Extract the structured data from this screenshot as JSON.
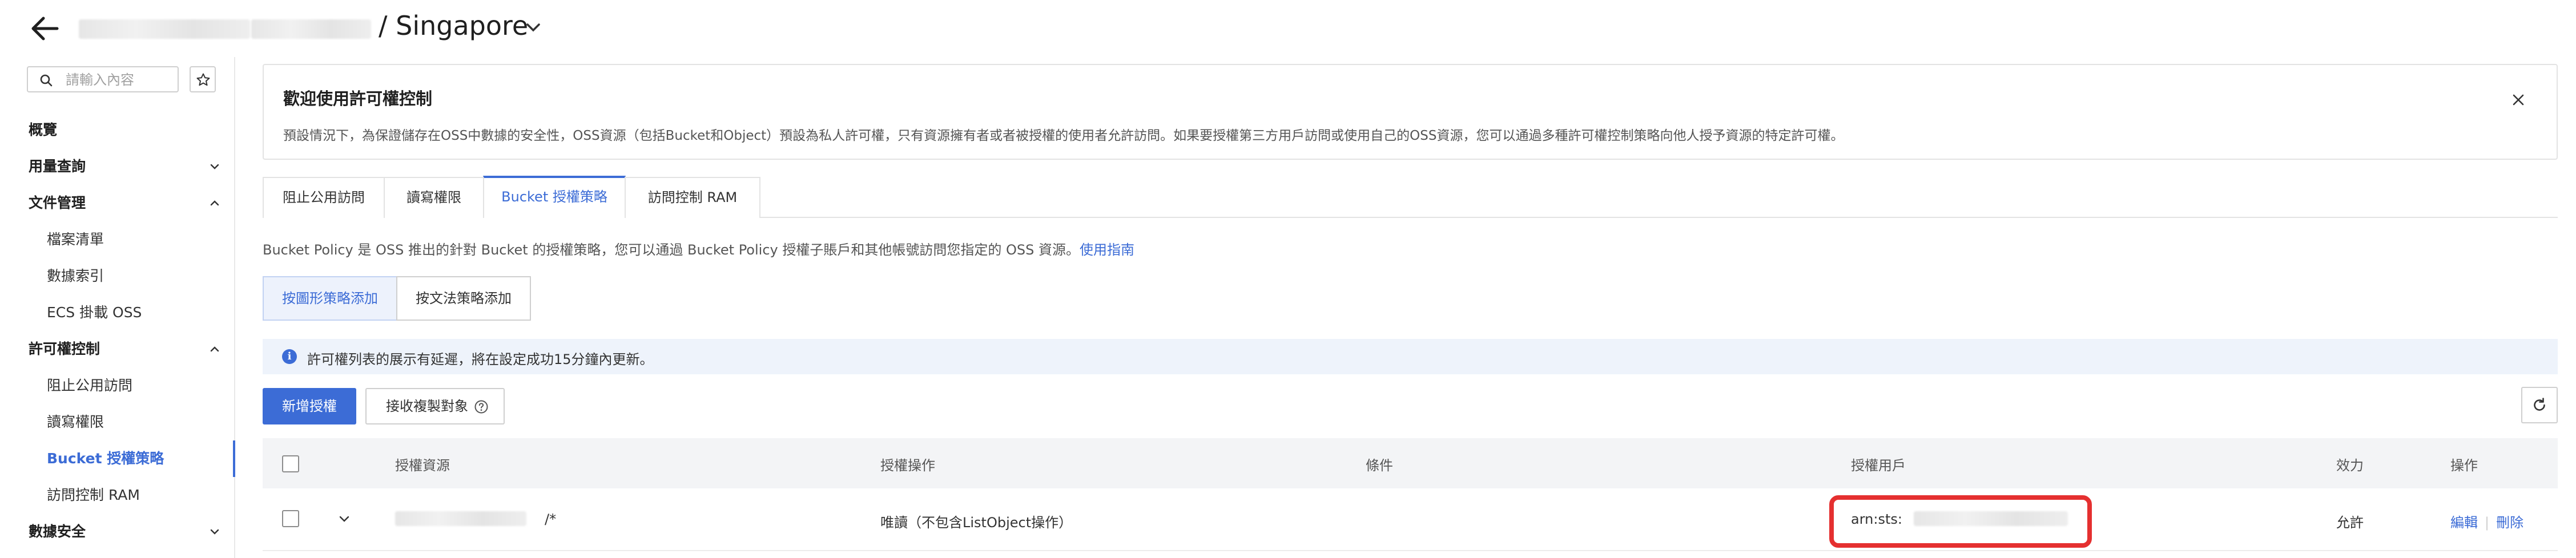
{
  "header": {
    "title": "/ Singapore"
  },
  "sidebar": {
    "search_placeholder": "請輸入內容",
    "items": [
      {
        "label": "概覽"
      },
      {
        "label": "用量查詢"
      },
      {
        "label": "文件管理"
      },
      {
        "label": "檔案清單"
      },
      {
        "label": "數據索引"
      },
      {
        "label": "ECS 掛載 OSS"
      },
      {
        "label": "許可權控制"
      },
      {
        "label": "阻止公用訪問"
      },
      {
        "label": "讀寫權限"
      },
      {
        "label": "Bucket 授權策略"
      },
      {
        "label": "訪問控制 RAM"
      },
      {
        "label": "數據安全"
      }
    ]
  },
  "banner": {
    "title": "歡迎使用許可權控制",
    "text": "預設情況下，為保證儲存在OSS中數據的安全性，OSS資源（包括Bucket和Object）預設為私人許可權，只有資源擁有者或者被授權的使用者允許訪問。如果要授權第三方用戶訪問或使用自己的OSS資源，您可以通過多種許可權控制策略向他人授予資源的特定許可權。"
  },
  "tabs": [
    {
      "label": "阻止公用訪問"
    },
    {
      "label": "讀寫權限"
    },
    {
      "label": "Bucket 授權策略"
    },
    {
      "label": "訪問控制 RAM"
    }
  ],
  "description": {
    "text": "Bucket Policy 是 OSS 推出的針對 Bucket 的授權策略，您可以通過 Bucket Policy 授權子賬戶和其他帳號訪問您指定的 OSS 資源。",
    "link": "使用指南"
  },
  "mode_buttons": {
    "graphic": "按圖形策略添加",
    "syntax": "按文法策略添加"
  },
  "info": {
    "text": "許可權列表的展示有延遲，將在設定成功15分鐘內更新。"
  },
  "actions": {
    "add": "新增授權",
    "receive_copy": "接收複製對象"
  },
  "table": {
    "headers": {
      "resource": "授權資源",
      "operation": "授權操作",
      "condition": "條件",
      "user": "授權用戶",
      "effect": "效力",
      "ops": "操作"
    },
    "rows": [
      {
        "resource_suffix": "/*",
        "operation": "唯讀（不包含ListObject操作）",
        "condition": "",
        "user_prefix": "arn:sts:",
        "effect": "允許",
        "edit": "編輯",
        "delete": "刪除"
      }
    ]
  },
  "colors": {
    "accent": "#3c6cd6",
    "highlight": "#e53030"
  }
}
